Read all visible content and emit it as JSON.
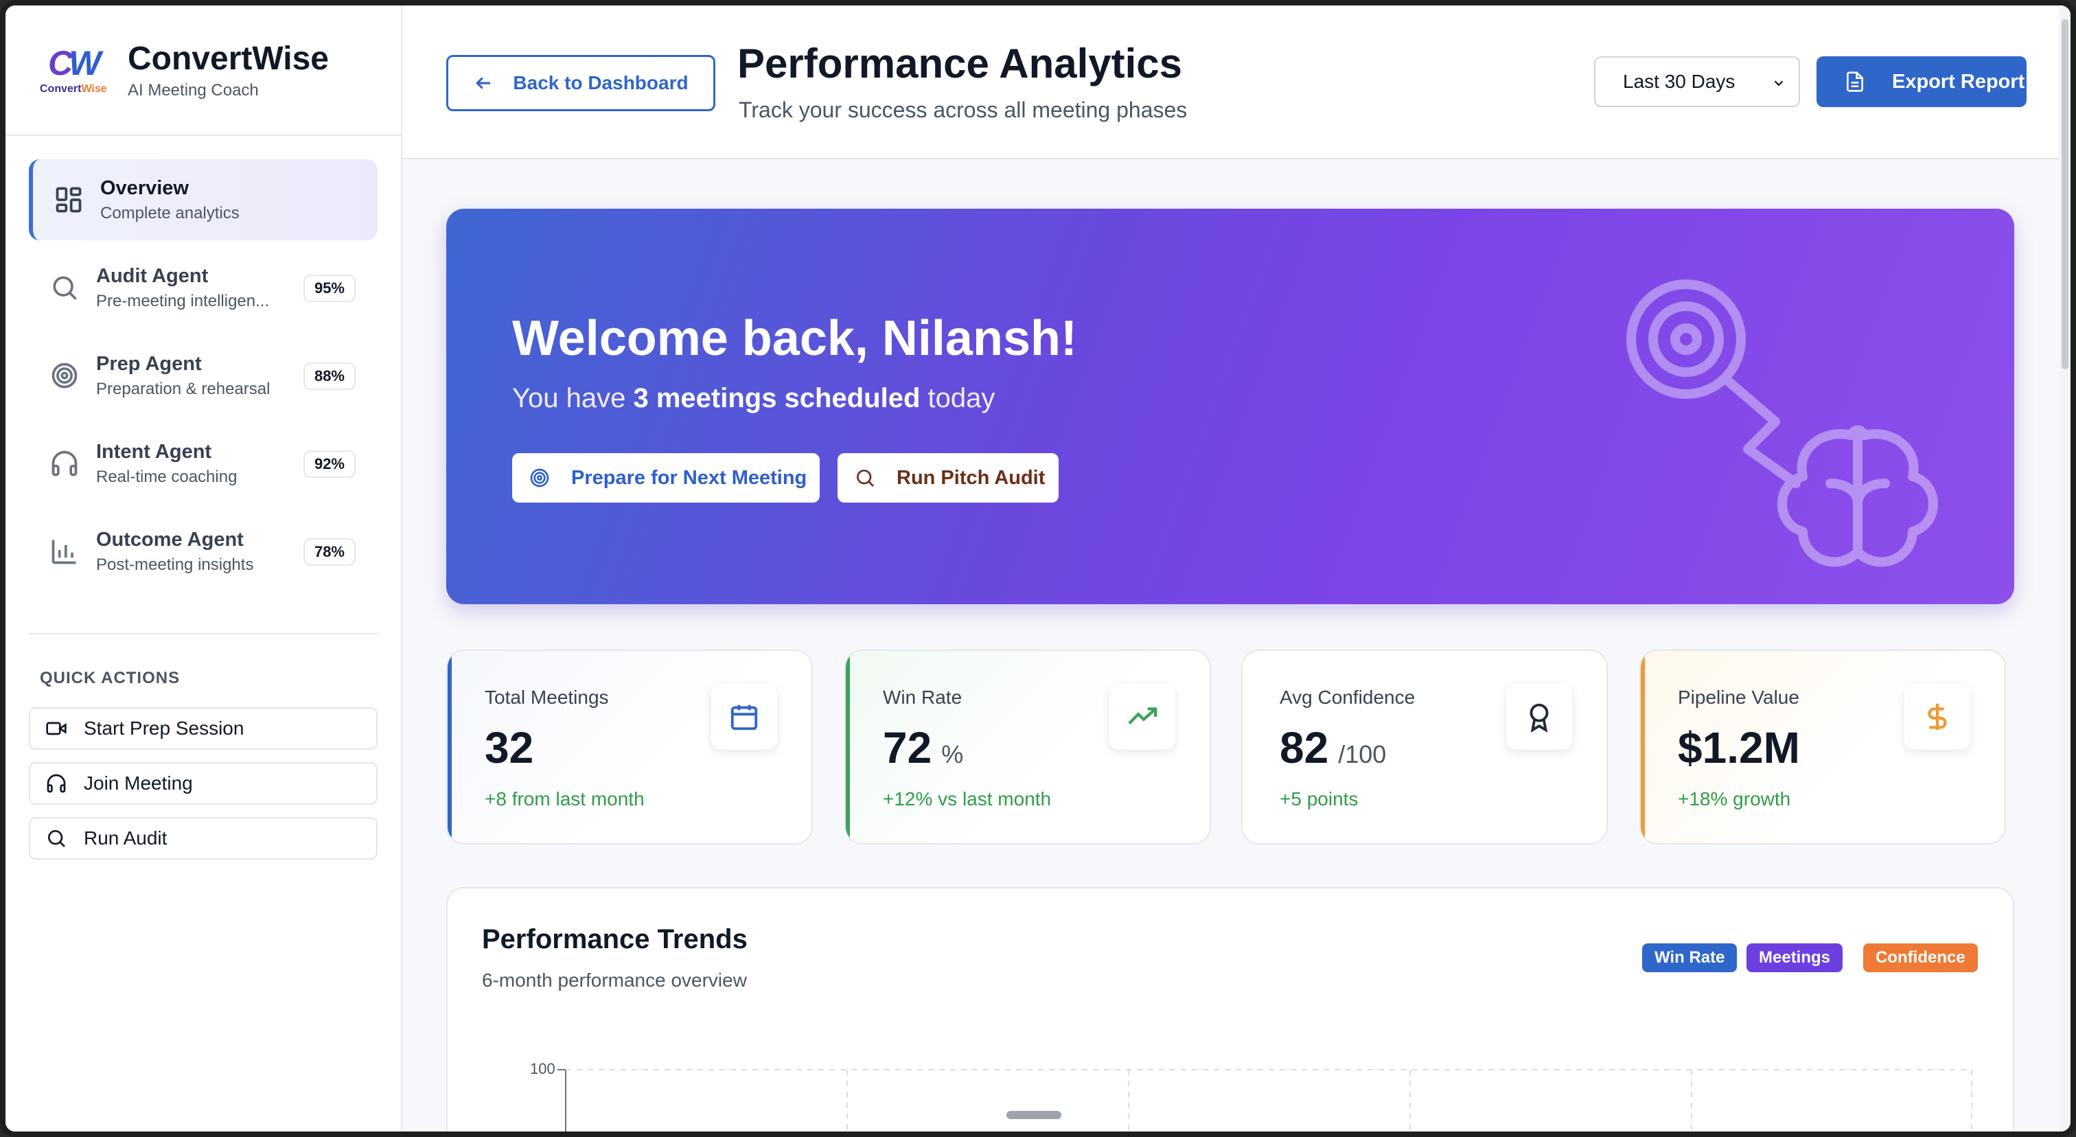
{
  "brand": {
    "logo_mark_c": "C",
    "logo_mark_w": "W",
    "logo_word_1": "Convert",
    "logo_word_2": "Wise",
    "name": "ConvertWise",
    "tagline": "AI Meeting Coach"
  },
  "sidebar": {
    "items": [
      {
        "label": "Overview",
        "desc": "Complete analytics",
        "icon": "grid-icon",
        "active": true
      },
      {
        "label": "Audit Agent",
        "desc": "Pre-meeting intelligen...",
        "badge": "95%",
        "icon": "search-icon"
      },
      {
        "label": "Prep Agent",
        "desc": "Preparation & rehearsal",
        "badge": "88%",
        "icon": "target-icon"
      },
      {
        "label": "Intent Agent",
        "desc": "Real-time coaching",
        "badge": "92%",
        "icon": "headphones-icon"
      },
      {
        "label": "Outcome Agent",
        "desc": "Post-meeting insights",
        "badge": "78%",
        "icon": "bar-chart-icon"
      }
    ],
    "quick_actions_title": "QUICK ACTIONS",
    "quick_actions": [
      {
        "label": "Start Prep Session",
        "icon": "video-icon"
      },
      {
        "label": "Join Meeting",
        "icon": "headphones-icon"
      },
      {
        "label": "Run Audit",
        "icon": "search-icon"
      }
    ]
  },
  "header": {
    "back_label": "Back to Dashboard",
    "title": "Performance Analytics",
    "subtitle": "Track your success across all meeting phases",
    "range_selected": "Last 30 Days",
    "export_label": "Export Report"
  },
  "hero": {
    "title": "Welcome back, Nilansh!",
    "sub_prefix": "You have ",
    "sub_bold": "3 meetings scheduled",
    "sub_suffix": " today",
    "primary_button": "Prepare for Next Meeting",
    "secondary_button": "Run Pitch Audit"
  },
  "stats": [
    {
      "label": "Total Meetings",
      "value": "32",
      "unit": "",
      "change": "+8 from last month",
      "icon": "calendar-icon",
      "accent": "#2f66c9"
    },
    {
      "label": "Win Rate",
      "value": "72",
      "unit": "%",
      "change": "+12% vs last month",
      "icon": "trending-up-icon",
      "accent": "#3aa35a"
    },
    {
      "label": "Avg Confidence",
      "value": "82",
      "unit": "/100",
      "change": "+5 points",
      "icon": "award-icon",
      "accent": "#e5e7eb"
    },
    {
      "label": "Pipeline Value",
      "value": "$1.2M",
      "unit": "",
      "change": "+18% growth",
      "icon": "dollar-icon",
      "accent": "#ee9a35"
    }
  ],
  "trends": {
    "title": "Performance Trends",
    "subtitle": "6-month performance overview",
    "legend": [
      "Win Rate",
      "Meetings",
      "Confidence"
    ],
    "y_top_tick": "100"
  },
  "colors": {
    "primary": "#2f66c9",
    "purple": "#6d3fe0",
    "orange": "#ee7a35",
    "green": "#2f9d4a"
  }
}
